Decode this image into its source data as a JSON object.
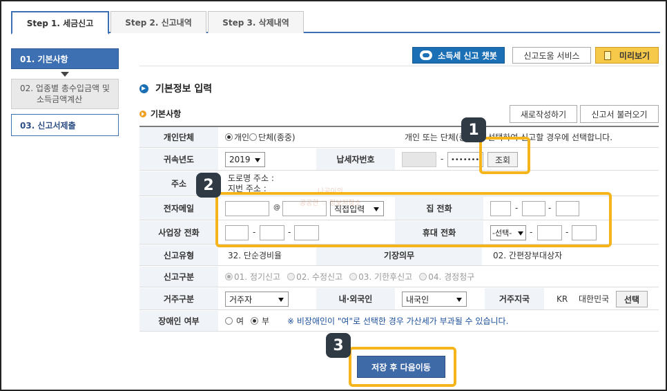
{
  "tabs": [
    {
      "label": "Step 1. 세금신고",
      "active": true
    },
    {
      "label": "Step 2. 신고내역",
      "active": false
    },
    {
      "label": "Step 3. 삭제내역",
      "active": false
    }
  ],
  "side_menu": [
    {
      "label": "01. 기본사항"
    },
    {
      "label_line1": "02. 업종별 총수입금액 및",
      "label_line2": "소득금액계산"
    },
    {
      "label": "03. 신고서제출"
    }
  ],
  "toolbar": {
    "chatbot": "소득세 신고 챗봇",
    "help": "신고도움 서비스",
    "preview": "미리보기"
  },
  "section_title": "기본정보 입력",
  "subsection_title": "기본사항",
  "actions": {
    "new": "새로작성하기",
    "load": "신고서 불러오기"
  },
  "form": {
    "entity": {
      "label": "개인단체",
      "opt1": "개인",
      "opt2": "단체(종중)",
      "note": "개인 또는 단체(종중)를 선택하여 신고할 경우에 선택합니다."
    },
    "year": {
      "label": "귀속년도",
      "value": "2019"
    },
    "taxpayer_id": {
      "label": "납세자번호",
      "masked": "•••••••",
      "lookup": "조회"
    },
    "address": {
      "label": "주소",
      "road": "도로명 주소 :",
      "lot": "지번 주소 :"
    },
    "email": {
      "label": "전자메일",
      "at": "@",
      "domain_select": "직접입력"
    },
    "home_phone": {
      "label": "집 전화"
    },
    "biz_phone": {
      "label": "사업장 전화"
    },
    "mobile": {
      "label": "휴대 전화",
      "select": "-선택-"
    },
    "report_type": {
      "label": "신고유형",
      "value": "32. 단순경비율"
    },
    "bookkeeping": {
      "label": "기장의무",
      "value": "02. 간편장부대상자"
    },
    "report_class": {
      "label": "신고구분",
      "opts": [
        "01. 정기신고",
        "02. 수정신고",
        "03. 기한후신고",
        "04. 경정청구"
      ]
    },
    "residence": {
      "label": "거주구분",
      "value": "거주자"
    },
    "nationality": {
      "label": "내·외국인",
      "value": "내국인"
    },
    "region": {
      "label": "거주지국",
      "code": "KR",
      "name": "대한민국",
      "button": "선택"
    },
    "disabled": {
      "label": "장애인 여부",
      "yes": "여",
      "no": "부",
      "note": "※ 비장애인이 \"여\"로 선택한 경우 가산세가 부과될 수 있습니다."
    }
  },
  "save_button": "저장 후 다음이동",
  "callouts": [
    "1",
    "2",
    "3"
  ],
  "watermark": [
    "나공이의",
    "공공한 ♡ 정보저장소"
  ],
  "colors": {
    "accent": "#3d6fb3",
    "highlight": "#f5b41a",
    "badge": "#2f3a45"
  }
}
